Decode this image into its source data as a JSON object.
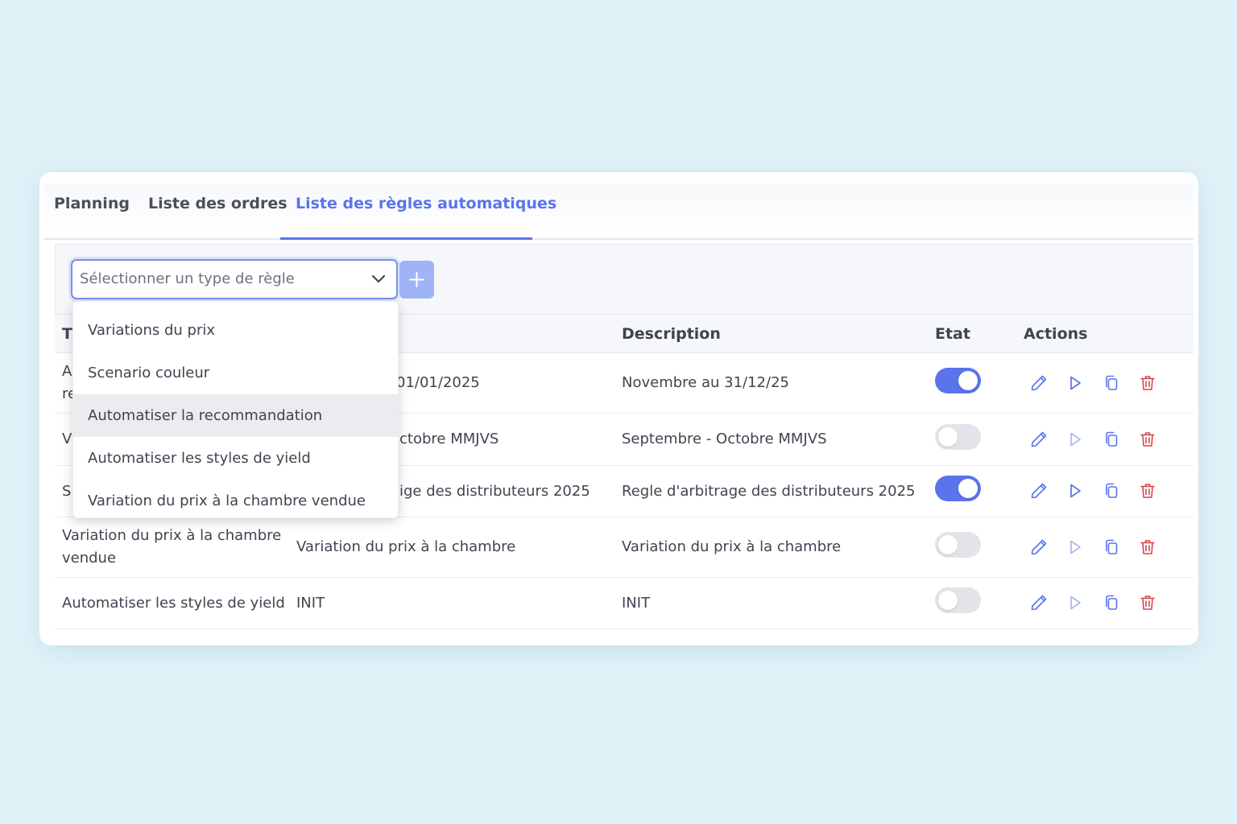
{
  "tabs": [
    {
      "label": "Planning",
      "active": false
    },
    {
      "label": "Liste des ordres",
      "active": false
    },
    {
      "label": "Liste des règles automatiques",
      "active": true
    }
  ],
  "toolbar": {
    "select_placeholder": "Sélectionner un type de règle",
    "add_icon": "plus-icon"
  },
  "dropdown": {
    "options": [
      "Variations du prix",
      "Scenario couleur",
      "Automatiser la recommandation",
      "Automatiser les styles de yield",
      "Variation du prix à la chambre vendue"
    ],
    "highlighted_index": 2
  },
  "table": {
    "headers": {
      "type": "T",
      "description": "Description",
      "etat": "Etat",
      "actions": "Actions"
    },
    "rows": [
      {
        "type_visible": "A\nre",
        "name_visible": "01/01/2025",
        "description": "Novembre au 31/12/25",
        "enabled": true
      },
      {
        "type_visible": "V",
        "name_visible": "ctobre MMJVS",
        "description": "Septembre - Octobre MMJVS",
        "enabled": false
      },
      {
        "type_visible": "S",
        "name_visible": "ige des distributeurs 2025",
        "description": "Regle d'arbitrage des distributeurs 2025",
        "enabled": true
      },
      {
        "type_visible": "Variation du prix à la chambre vendue",
        "name_visible": "Variation du prix à la chambre",
        "description": "Variation du prix à la chambre",
        "enabled": false
      },
      {
        "type_visible": "Automatiser les styles de yield",
        "name_visible": "INIT",
        "description": "INIT",
        "enabled": false
      }
    ],
    "action_icons": [
      "pencil-icon",
      "play-icon",
      "copy-icon",
      "trash-icon"
    ]
  },
  "colors": {
    "accent": "#5a74ec",
    "background": "#e1f2f8",
    "toggle_off": "#e3e4e9",
    "delete": "#d9434a",
    "add_button": "#9fb4f6"
  }
}
